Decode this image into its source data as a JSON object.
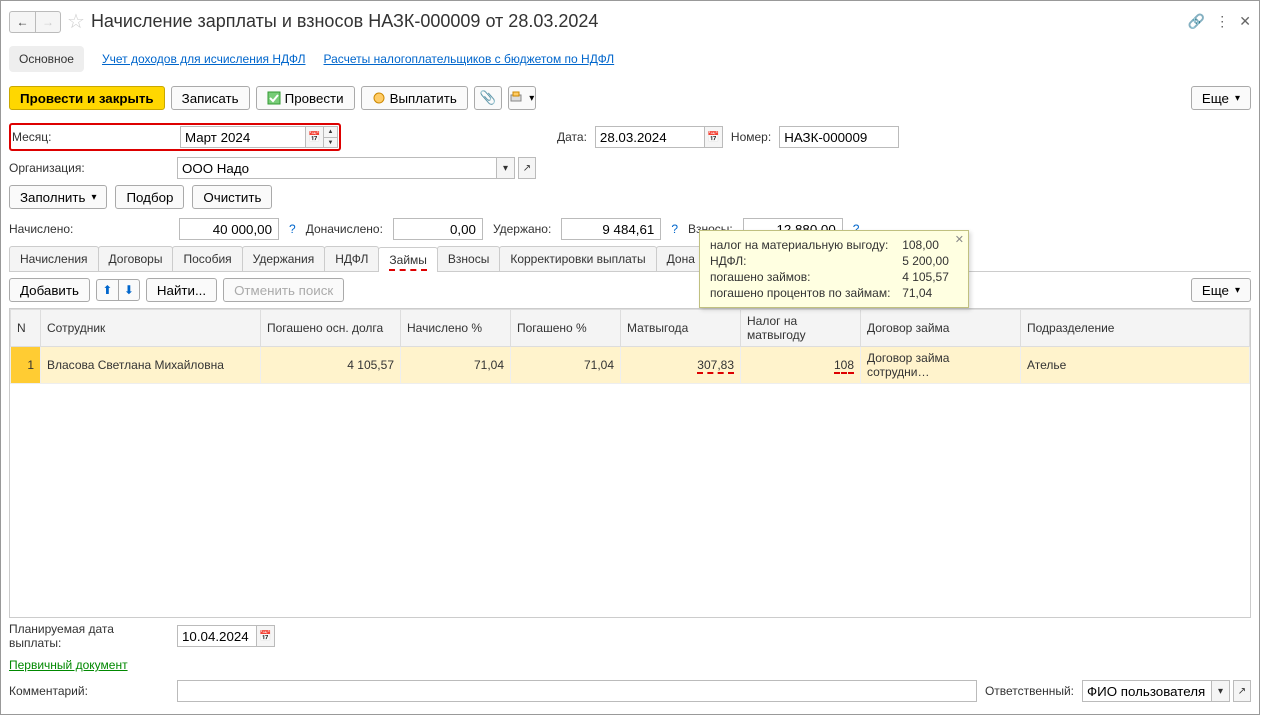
{
  "title": "Начисление зарплаты и взносов НАЗК-000009 от 28.03.2024",
  "navbar": {
    "main": "Основное",
    "link1": "Учет доходов для исчисления НДФЛ",
    "link2": "Расчеты налогоплательщиков с бюджетом по НДФЛ"
  },
  "toolbar": {
    "post_close": "Провести и закрыть",
    "save": "Записать",
    "post": "Провести",
    "pay": "Выплатить",
    "more": "Еще"
  },
  "fields": {
    "month_label": "Месяц:",
    "month_value": "Март 2024",
    "date_label": "Дата:",
    "date_value": "28.03.2024",
    "number_label": "Номер:",
    "number_value": "НАЗК-000009",
    "org_label": "Организация:",
    "org_value": "ООО Надо"
  },
  "buttons": {
    "fill": "Заполнить",
    "select": "Подбор",
    "clear": "Очистить",
    "add": "Добавить",
    "find": "Найти...",
    "cancel_find": "Отменить поиск"
  },
  "summary": {
    "accrued_label": "Начислено:",
    "accrued_value": "40 000,00",
    "additional_label": "Доначислено:",
    "additional_value": "0,00",
    "withheld_label": "Удержано:",
    "withheld_value": "9 484,61",
    "contrib_label": "Взносы:",
    "contrib_value": "12 880,00"
  },
  "tabs": {
    "accruals": "Начисления",
    "contracts": "Договоры",
    "benefits": "Пособия",
    "deductions": "Удержания",
    "ndfl": "НДФЛ",
    "loans": "Займы",
    "contributions": "Взносы",
    "corrections": "Корректировки выплаты",
    "additional": "Дона"
  },
  "table": {
    "headers": {
      "n": "N",
      "employee": "Сотрудник",
      "principal": "Погашено осн. долга",
      "accrued_pct": "Начислено %",
      "repaid_pct": "Погашено %",
      "matbenefit": "Матвыгода",
      "tax_matbenefit": "Налог на матвыгоду",
      "loan_contract": "Договор займа",
      "department": "Подразделение"
    },
    "rows": [
      {
        "n": "1",
        "employee": "Власова Светлана Михайловна",
        "principal": "4 105,57",
        "accrued_pct": "71,04",
        "repaid_pct": "71,04",
        "matbenefit": "307,83",
        "tax_matbenefit": "108",
        "loan_contract": "Договор займа сотрудни…",
        "department": "Ателье"
      }
    ]
  },
  "tooltip": {
    "r1_label": "налог на материальную выгоду:",
    "r1_value": "108,00",
    "r2_label": "НДФЛ:",
    "r2_value": "5 200,00",
    "r3_label": "погашено займов:",
    "r3_value": "4 105,57",
    "r4_label": "погашено процентов по займам:",
    "r4_value": "71,04"
  },
  "bottom": {
    "plan_date_label": "Планируемая дата выплаты:",
    "plan_date_value": "10.04.2024",
    "primary_doc": "Первичный документ",
    "comment_label": "Комментарий:",
    "responsible_label": "Ответственный:",
    "responsible_value": "ФИО пользователя"
  }
}
